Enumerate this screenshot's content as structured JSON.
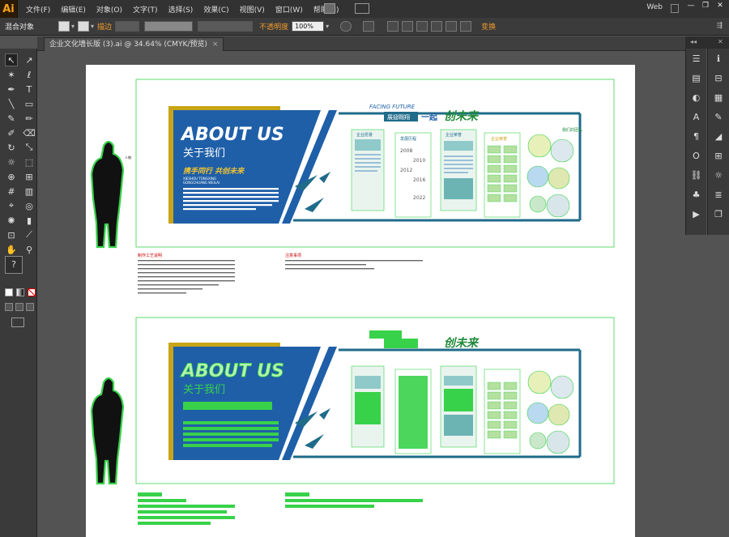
{
  "app": {
    "logo": "Ai"
  },
  "menu": [
    "文件(F)",
    "编辑(E)",
    "对象(O)",
    "文字(T)",
    "选择(S)",
    "效果(C)",
    "视图(V)",
    "窗口(W)",
    "帮助(H)"
  ],
  "workspace": "Web",
  "window_buttons": [
    "—",
    "❐",
    "✕"
  ],
  "control": {
    "selection_type": "混合对象",
    "stroke_label": "描边",
    "opacity_label": "不透明度",
    "opacity_value": "100%",
    "transform_label": "变换"
  },
  "document": {
    "tab_title": "企业文化墙长版 (3).ai @ 34.64% (CMYK/预览)",
    "close": "×"
  },
  "tools": [
    {
      "icon": "selection-arrow-icon",
      "glyph": "↖"
    },
    {
      "icon": "direct-selection-icon",
      "glyph": "↗"
    },
    {
      "icon": "magic-wand-icon",
      "glyph": "✶"
    },
    {
      "icon": "lasso-icon",
      "glyph": "ℓ"
    },
    {
      "icon": "pen-icon",
      "glyph": "✒"
    },
    {
      "icon": "type-icon",
      "glyph": "T"
    },
    {
      "icon": "line-icon",
      "glyph": "╲"
    },
    {
      "icon": "rectangle-icon",
      "glyph": "▭"
    },
    {
      "icon": "paintbrush-icon",
      "glyph": "✎"
    },
    {
      "icon": "pencil-icon",
      "glyph": "✏"
    },
    {
      "icon": "blob-brush-icon",
      "glyph": "✐"
    },
    {
      "icon": "eraser-icon",
      "glyph": "⌫"
    },
    {
      "icon": "rotate-icon",
      "glyph": "↻"
    },
    {
      "icon": "scale-icon",
      "glyph": "⤡"
    },
    {
      "icon": "warp-icon",
      "glyph": "☼"
    },
    {
      "icon": "free-transform-icon",
      "glyph": "⬚"
    },
    {
      "icon": "shape-builder-icon",
      "glyph": "⊕"
    },
    {
      "icon": "perspective-icon",
      "glyph": "⊞"
    },
    {
      "icon": "mesh-icon",
      "glyph": "#"
    },
    {
      "icon": "gradient-icon",
      "glyph": "▥"
    },
    {
      "icon": "eyedropper-icon",
      "glyph": "⌖"
    },
    {
      "icon": "blend-icon",
      "glyph": "◎"
    },
    {
      "icon": "symbol-sprayer-icon",
      "glyph": "✺"
    },
    {
      "icon": "graph-icon",
      "glyph": "▮"
    },
    {
      "icon": "artboard-icon",
      "glyph": "⊡"
    },
    {
      "icon": "slice-icon",
      "glyph": "⟋"
    },
    {
      "icon": "hand-icon",
      "glyph": "✋"
    },
    {
      "icon": "zoom-icon",
      "glyph": "⚲"
    }
  ],
  "question_tool": "?",
  "right_panel_icons": [
    "color-icon",
    "gradient-panel-icon",
    "transparency-icon",
    "character-icon",
    "paragraph-icon",
    "opentype-icon",
    "links-icon",
    "symbols-icon",
    "actions-icon"
  ],
  "right_panel_icons2": [
    "info-icon",
    "align-icon",
    "swatches-icon",
    "brushes-icon",
    "graphic-styles-icon",
    "transform-icon",
    "appearance-icon",
    "layers-icon",
    "artboards-icon"
  ],
  "artwork": {
    "heading": "ABOUT US",
    "sub_heading": "关于我们",
    "slogan": "携手同行 共创未来",
    "pinyin_1": "XIESHOU TONGXING",
    "pinyin_2": "GONGCHUANG WEILAI",
    "facing_future": "FACING FUTURE",
    "tag_green": "展翅翱翔",
    "together": "一起",
    "script_title": "创未来",
    "panel1": "企业愿景",
    "panel2": "发展历程",
    "panel3": "企业荣誉",
    "panel4": "企业荣誉",
    "years": [
      "2008",
      "2010",
      "2012",
      "2016",
      "2022"
    ],
    "our_team": "我们的团队",
    "note_left_title": "制作工艺说明",
    "note_right_title": "注意事项",
    "figure_label": "人物"
  },
  "colors": {
    "brand_blue": "#1f5fa8",
    "gold": "#c8a417",
    "green": "#38d24a",
    "teal": "#1f6b8a"
  }
}
